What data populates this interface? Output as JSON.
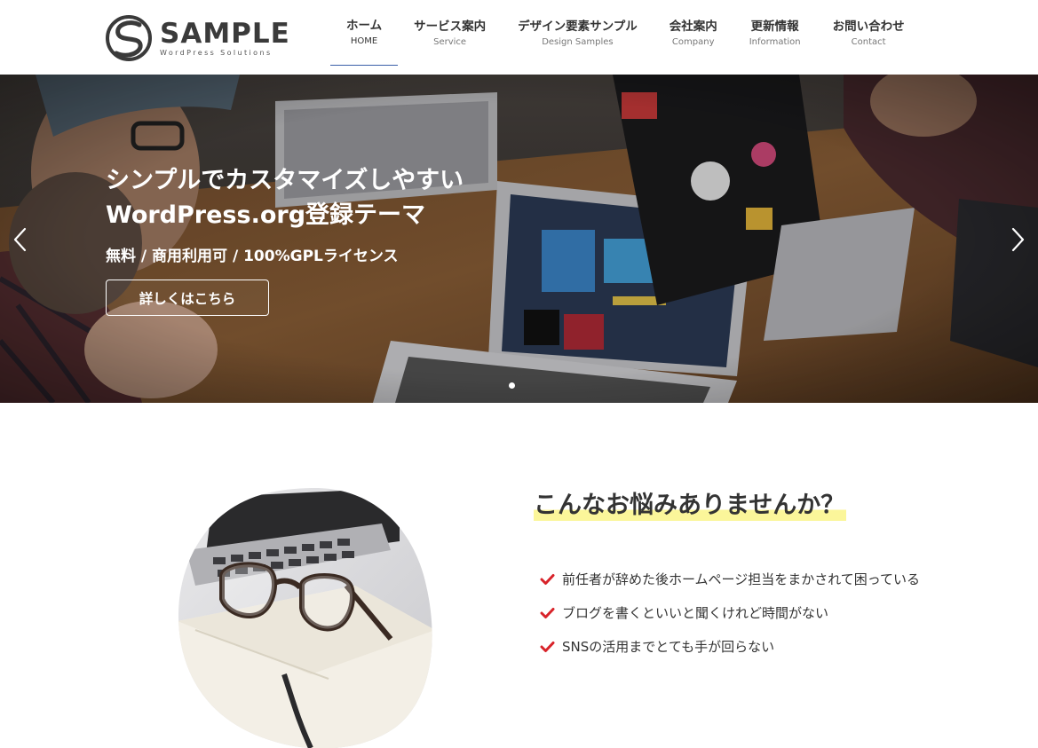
{
  "header": {
    "logo_title": "SAMPLE",
    "logo_subtitle": "WordPress Solutions",
    "nav": [
      {
        "label": "ホーム",
        "sub": "HOME"
      },
      {
        "label": "サービス案内",
        "sub": "Service"
      },
      {
        "label": "デザイン要素サンプル",
        "sub": "Design Samples"
      },
      {
        "label": "会社案内",
        "sub": "Company"
      },
      {
        "label": "更新情報",
        "sub": "Information"
      },
      {
        "label": "お問い合わせ",
        "sub": "Contact"
      }
    ]
  },
  "hero": {
    "title_line1": "シンプルでカスタマイズしやすい",
    "title_line2": "WordPress.org登録テーマ",
    "subtitle": "無料 / 商用利用可 / 100%GPLライセンス",
    "button_label": "詳しくはこちら"
  },
  "worries": {
    "title": "こんなお悩みありませんか？",
    "items": [
      "前任者が辞めた後ホームページ担当をまかされて困っている",
      " ブログを書くといいと聞くけれど時間がない",
      "SNSの活用までとても手が回らない"
    ]
  },
  "colors": {
    "accent": "#3a5fa8",
    "check": "#d8232a",
    "highlight": "#fbf69a"
  },
  "icons": {
    "prev": "chevron-left-icon",
    "next": "chevron-right-icon",
    "check": "check-icon",
    "logo": "logo-s-icon"
  }
}
